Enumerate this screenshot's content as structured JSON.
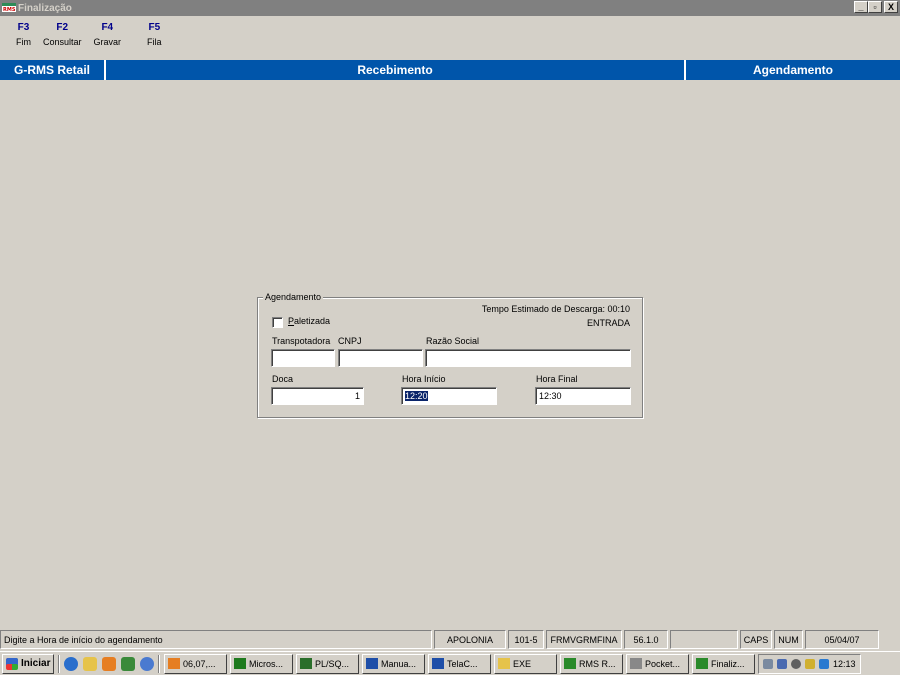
{
  "window": {
    "title": "Finalização",
    "app_icon": "rms-app-icon",
    "controls": [
      "_",
      "▫",
      "X"
    ]
  },
  "toolbar": {
    "keys": [
      {
        "key": "F3",
        "label": "Fim"
      },
      {
        "key": "F2",
        "label": "Consultar"
      },
      {
        "key": "F4",
        "label": "Gravar"
      },
      {
        "key": "F5",
        "label": "Fila"
      }
    ]
  },
  "header": {
    "left": "G-RMS Retail",
    "middle": "Recebimento",
    "right": "Agendamento",
    "color": "#0055aa"
  },
  "form": {
    "group_title": "Agendamento",
    "tempo_estimado": "Tempo Estimado de Descarga: 00:10",
    "tipo": "ENTRADA",
    "paletizada_label_first": "P",
    "paletizada_label_rest": "aletizada",
    "paletizada_checked": false,
    "transportadora_label": "Transpotadora",
    "transportadora_value": "",
    "cnpj_label": "CNPJ",
    "cnpj_value": "",
    "razao_social_label": "Razão Social",
    "razao_social_value": "",
    "doca_label": "Doca",
    "doca_value": "1",
    "hora_inicio_label": "Hora Início",
    "hora_inicio_value": "12:20",
    "hora_final_label": "Hora Final",
    "hora_final_value": "12:30"
  },
  "statusbar": {
    "message": "Digite a Hora de início do agendamento",
    "server": "APOLONIA",
    "code": "101-5",
    "form": "FRMVGRMFINA",
    "version": "56.1.0",
    "empty": "",
    "caps": "CAPS",
    "num": "NUM",
    "date": "05/04/07"
  },
  "taskbar": {
    "start_label": "Iniciar",
    "quicklaunch": [
      "ie-icon",
      "folder-icon",
      "app-icon",
      "media-icon",
      "globe-icon"
    ],
    "tasks": [
      {
        "label": "06,07,...",
        "icon": "toad-icon",
        "color": "#e67e22"
      },
      {
        "label": "Micros...",
        "icon": "excel-icon",
        "color": "#1e7a1e"
      },
      {
        "label": "PL/SQ...",
        "icon": "plsql-icon",
        "color": "#2a6e2a"
      },
      {
        "label": "Manua...",
        "icon": "word-icon",
        "color": "#1f4fa8"
      },
      {
        "label": "TelaC...",
        "icon": "word-icon",
        "color": "#1f4fa8"
      },
      {
        "label": "EXE",
        "icon": "folder-icon",
        "color": "#e6c34a"
      },
      {
        "label": "RMS R...",
        "icon": "rms-icon",
        "color": "#2a8a2a"
      },
      {
        "label": "Pocket...",
        "icon": "pocket-icon",
        "color": "#888888"
      },
      {
        "label": "Finaliz...",
        "icon": "rms-icon",
        "color": "#2a8a2a"
      }
    ],
    "clock": "12:13"
  }
}
